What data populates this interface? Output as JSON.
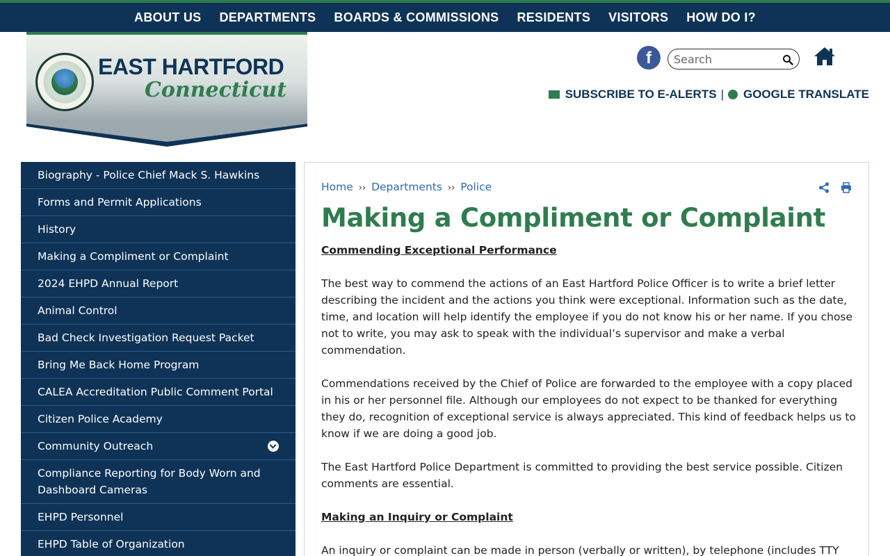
{
  "topnav": [
    "ABOUT US",
    "DEPARTMENTS",
    "BOARDS & COMMISSIONS",
    "RESIDENTS",
    "VISITORS",
    "HOW DO I?"
  ],
  "logo": {
    "title": "EAST HARTFORD",
    "subtitle": "Connecticut"
  },
  "header": {
    "search_placeholder": "Search",
    "subscribe": "SUBSCRIBE TO E-ALERTS",
    "separator": "|",
    "translate": "GOOGLE TRANSLATE"
  },
  "sidebar": {
    "items": [
      {
        "label": "Biography - Police Chief Mack S. Hawkins"
      },
      {
        "label": "Forms and Permit Applications"
      },
      {
        "label": "History"
      },
      {
        "label": "Making a Compliment or Complaint"
      },
      {
        "label": "2024 EHPD Annual Report"
      },
      {
        "label": "Animal Control"
      },
      {
        "label": "Bad Check Investigation Request Packet"
      },
      {
        "label": "Bring Me Back Home Program"
      },
      {
        "label": "CALEA Accreditation Public Comment Portal"
      },
      {
        "label": "Citizen Police Academy"
      },
      {
        "label": "Community Outreach",
        "expandable": true
      },
      {
        "label": "Compliance Reporting for Body Worn and Dashboard Cameras"
      },
      {
        "label": "EHPD Personnel"
      },
      {
        "label": "EHPD Table of Organization"
      }
    ]
  },
  "breadcrumb": {
    "home": "Home",
    "sep": "››",
    "departments": "Departments",
    "police": "Police"
  },
  "page": {
    "title": "Making a Compliment or Complaint",
    "heading1": "Commending Exceptional Performance",
    "para1": "The best way to commend the actions of an East Hartford Police Officer is to write a brief letter describing the incident and the actions you think were exceptional. Information such as the date, time, and location will help identify the employee if you do not know his or her name. If you chose not to write, you may ask to speak with the individual’s supervisor and make a verbal commendation.",
    "para2": "Commendations received by the Chief of Police are forwarded to the employee with a copy placed in his or her personnel file. Although our employees do not expect to be thanked for everything they do, recognition of exceptional service is always appreciated. This kind of feedback helps us to know if we are doing a good job.",
    "para3": "The East Hartford Police Department is committed to providing the best service possible. Citizen comments are essential.",
    "heading2": "Making an Inquiry or Complaint",
    "para4": "An inquiry or complaint can be made in person (verbally or written), by telephone (includes TTY"
  },
  "colors": {
    "navy": "#0e3356",
    "green": "#2f7d4f",
    "link": "#2d6db5"
  },
  "icons": [
    "facebook-icon",
    "search-icon",
    "home-icon",
    "envelope-icon",
    "globe-icon",
    "share-icon",
    "print-icon",
    "chevron-down-icon"
  ]
}
